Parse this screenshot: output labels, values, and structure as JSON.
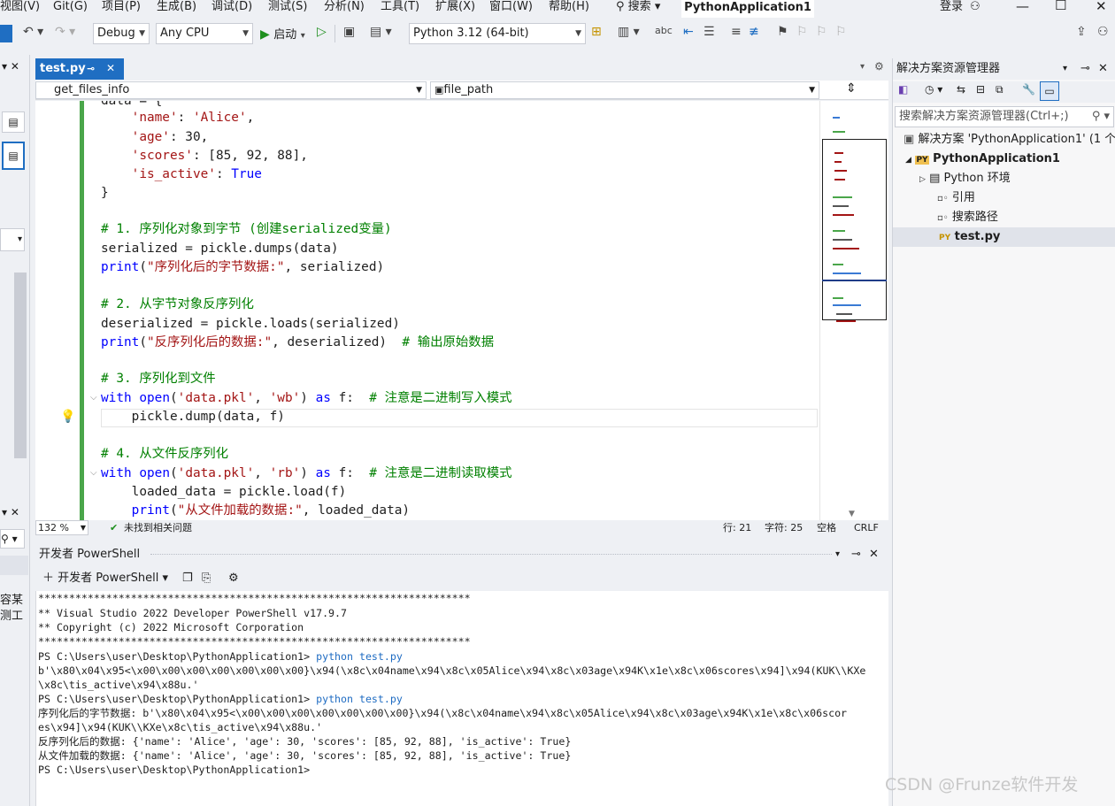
{
  "menu": {
    "items": [
      "视图(V)",
      "Git(G)",
      "项目(P)",
      "生成(B)",
      "调试(D)",
      "测试(S)",
      "分析(N)",
      "工具(T)",
      "扩展(X)",
      "窗口(W)",
      "帮助(H)"
    ],
    "search_label": "搜索",
    "window_title": "PythonApplication1",
    "login_label": "登录"
  },
  "toolbar": {
    "config": "Debug",
    "platform": "Any CPU",
    "start_label": "启动",
    "python_env": "Python 3.12 (64-bit)"
  },
  "editor": {
    "tab_label": "test.py",
    "nav_left": "get_files_info",
    "nav_right": "file_path",
    "zoom": "132 %",
    "issues": "未找到相关问题",
    "line": "行: 21",
    "char": "字符: 25",
    "spaces": "空格",
    "eol": "CRLF",
    "code": {
      "l0_a": "data = {",
      "l1_key": "'name'",
      "l1_val": "'Alice'",
      "l2_key": "'age'",
      "l2_val": ": 30,",
      "l3_key": "'scores'",
      "l3_val": ": [85, 92, 88],",
      "l4_key": "'is_active'",
      "l4_val": "True",
      "l5": "}",
      "c1": "# 1. 序列化对象到字节 (创建serialized变量)",
      "l7": "serialized = pickle.dumps(data)",
      "l8_fn": "print",
      "l8_str": "\"序列化后的字节数据:\"",
      "l8_rest": ", serialized)",
      "c2": "# 2. 从字节对象反序列化",
      "l11": "deserialized = pickle.loads(serialized)",
      "l12_fn": "print",
      "l12_str": "\"反序列化后的数据:\"",
      "l12_rest": ", deserialized)  ",
      "l12_cm": "# 输出原始数据",
      "c3": "# 3. 序列化到文件",
      "l15_kw": "with",
      "l15_fn": "open",
      "l15_s1": "'data.pkl'",
      "l15_s2": "'wb'",
      "l15_as": "as",
      "l15_f": " f:  ",
      "l15_cm": "# 注意是二进制写入模式",
      "l16": "    pickle.dump(data, f)",
      "c4": "# 4. 从文件反序列化",
      "l19_s2": "'rb'",
      "l19_cm": "# 注意是二进制读取模式",
      "l20": "    loaded_data = pickle.load(f)",
      "l21_fn": "    print",
      "l21_str": "\"从文件加载的数据:\"",
      "l21_rest": ", loaded_data)"
    }
  },
  "terminal": {
    "title": "开发者 PowerShell",
    "new_label": "开发者 PowerShell",
    "lines": [
      "**********************************************************************",
      "** Visual Studio 2022 Developer PowerShell v17.9.7",
      "** Copyright (c) 2022 Microsoft Corporation",
      "**********************************************************************",
      "PS C:\\Users\\user\\Desktop\\PythonApplication1> ",
      "b'\\x80\\x04\\x95<\\x00\\x00\\x00\\x00\\x00\\x00\\x00}\\x94(\\x8c\\x04name\\x94\\x8c\\x05Alice\\x94\\x8c\\x03age\\x94K\\x1e\\x8c\\x06scores\\x94]\\x94(KUK\\\\KXe",
      "\\x8c\\tis_active\\x94\\x88u.'",
      "PS C:\\Users\\user\\Desktop\\PythonApplication1> ",
      "序列化后的字节数据: b'\\x80\\x04\\x95<\\x00\\x00\\x00\\x00\\x00\\x00\\x00}\\x94(\\x8c\\x04name\\x94\\x8c\\x05Alice\\x94\\x8c\\x03age\\x94K\\x1e\\x8c\\x06scor",
      "es\\x94]\\x94(KUK\\\\KXe\\x8c\\tis_active\\x94\\x88u.'",
      "反序列化后的数据: {'name': 'Alice', 'age': 30, 'scores': [85, 92, 88], 'is_active': True}",
      "从文件加载的数据: {'name': 'Alice', 'age': 30, 'scores': [85, 92, 88], 'is_active': True}",
      "PS C:\\Users\\user\\Desktop\\PythonApplication1>"
    ],
    "cmd": "python test.py"
  },
  "solution": {
    "title": "解决方案资源管理器",
    "search_placeholder": "搜索解决方案资源管理器(Ctrl+;)",
    "root": "解决方案 'PythonApplication1' (1 个",
    "project": "PythonApplication1",
    "env": "Python 环境",
    "refs": "引用",
    "search_paths": "搜索路径",
    "file": "test.py",
    "py_badge": "PY"
  },
  "watermark": "CSDN @Frunze软件开发"
}
